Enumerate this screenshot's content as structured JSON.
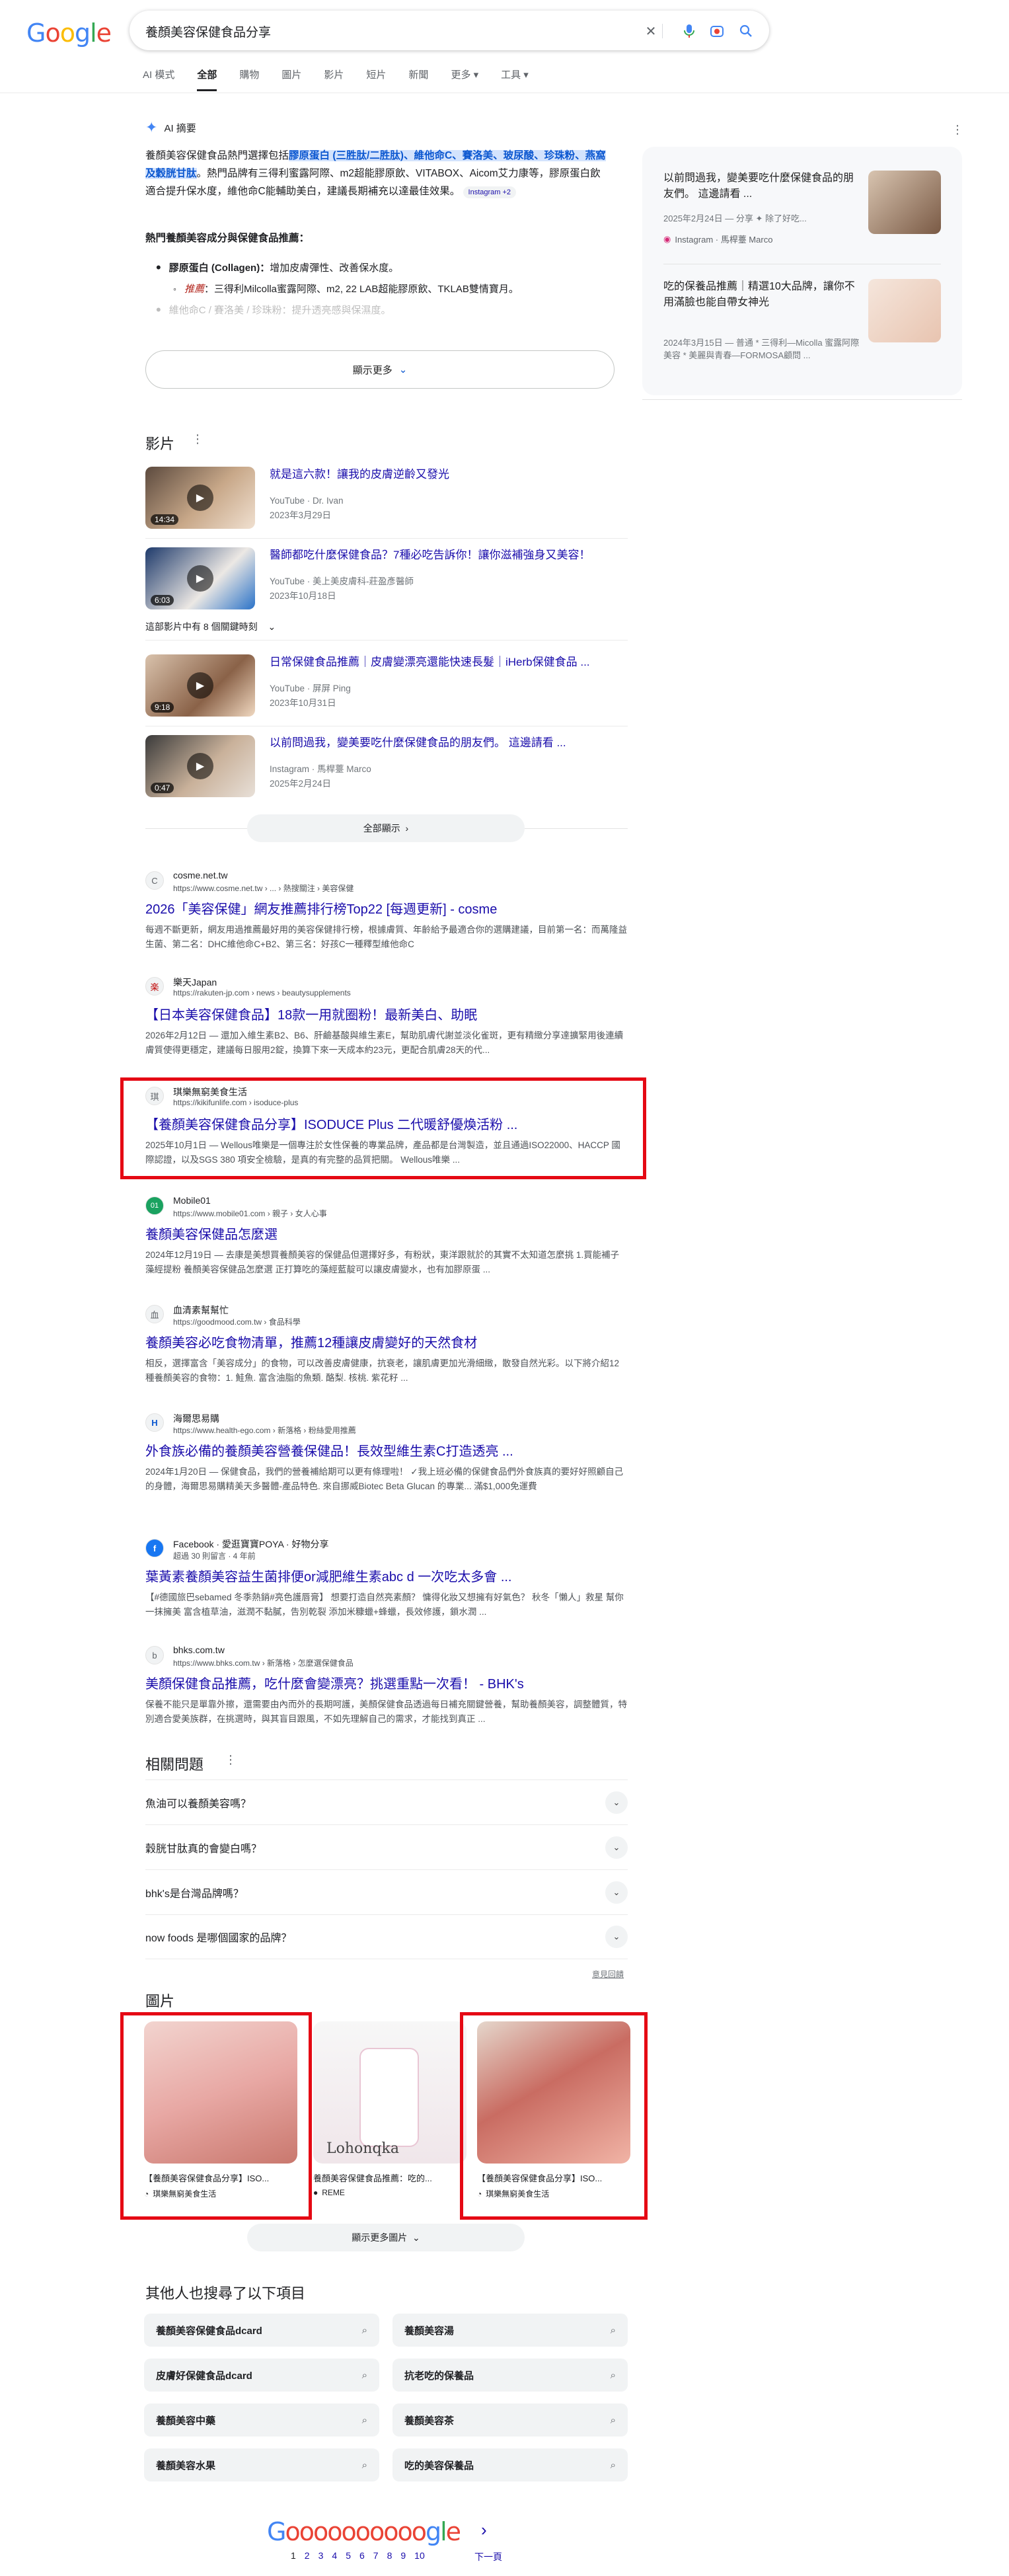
{
  "header": {
    "logo": "Google",
    "search_query": "養顏美容保健食品分享",
    "nav_tabs": [
      "AI 模式",
      "全部",
      "購物",
      "圖片",
      "影片",
      "短片",
      "新聞",
      "更多 ▾",
      "工具 ▾"
    ]
  },
  "ai_overview": {
    "label": "AI 摘要",
    "p1_a": "養顏美容保健食品熱門選擇包括",
    "p1_hl": "膠原蛋白 (三胜肽/二胜肽)、維他命C、賽洛美、玻尿酸、珍珠粉、燕窩及穀胱甘肽",
    "p1_b": "。熱門品牌有三得利蜜露阿際、m2超能膠原飲、VITABOX、Aicom艾力康等，膠原蛋白飲適合提升保水度，維他命C能輔助美白，建議長期補充以達最佳效果。",
    "p1_pill": "Instagram +2",
    "heading": "熱門養顏美容成分與保健食品推薦：",
    "bullet1_label": "膠原蛋白 (Collagen)：",
    "bullet1_text": "增加皮膚彈性、改善保水度。",
    "sub_label": "推薦",
    "sub_text": "三得利Milcolla蜜露阿際、m2, 22 LAB超能膠原飲、TKLAB雙情寶月。",
    "bullet2_text": "維他命C / 賽洛美 / 珍珠粉：",
    "bullet2_more": "提升透亮感與保濕度。",
    "show_more": "顯示更多",
    "side_cards": [
      {
        "title": "以前問過我，變美要吃什麼保健食品的朋友們。 這邊請看 ...",
        "meta": "2025年2月24日 — 分享 ✦ 除了好吃...",
        "source": "Instagram · 馬桿薹 Marco"
      },
      {
        "title": "吃的保養品推薦｜精選10大品牌，讓你不用滿臉也能自帶女神光",
        "meta": "2024年3月15日 — 普通 * 三得利—Micolla 蜜露阿際美容 * 美麗與青春—FORMOSA顧問 ...",
        "source": ""
      }
    ]
  },
  "videos": {
    "title": "影片",
    "items": [
      {
        "title": "就是這六款！讓我的皮膚逆齡又發光",
        "source": "YouTube · Dr. Ivan",
        "date": "2023年3月29日",
        "duration": "14:34"
      },
      {
        "title": "醫師都吃什麼保健食品？7種必吃告訴你！讓你滋補強身又美容！",
        "source": "YouTube · 美上美皮膚科-莊盈彥醫師",
        "date": "2023年10月18日",
        "duration": "6:03"
      },
      {
        "title": "日常保健食品推薦｜皮膚變漂亮還能快速長髮｜iHerb保健食品 ...",
        "source": "YouTube · 屏屏 Ping",
        "date": "2023年10月31日",
        "duration": "9:18"
      },
      {
        "title": "以前問過我，變美要吃什麼保健食品的朋友們。 這邊請看 ...",
        "source": "Instagram · 馬桿薹 Marco",
        "date": "2025年2月24日",
        "duration": "0:47"
      }
    ],
    "key_moments": "這部影片中有 8 個關鍵時刻",
    "show_all": "全部顯示"
  },
  "results": [
    {
      "site": "cosme.net.tw",
      "url": "https://www.cosme.net.tw › ... › 熱搜關注 › 美容保健",
      "title": "2026「美容保健」網友推薦排行榜Top22 [每週更新] - cosme",
      "snippet": "每週不斷更新，網友用過推薦最好用的美容保健排行榜，根據膚質、年齡給予最適合你的選購建議，目前第一名：而萬隆益生菌、第二名：DHC維他命C+B2、第三名：好孩C一種釋型維他命C",
      "favicon": "C"
    },
    {
      "site": "樂天Japan",
      "url": "https://rakuten-jp.com › news › beautysupplements",
      "title": "【日本美容保健食品】18款一用就圈粉！最新美白、助眠",
      "snippet": "2026年2月12日 — 還加入維生素B2、B6、肝鹼基酸與維生素E，幫助肌膚代謝並淡化雀斑，更有精緻分享達擴緊用後連續膚質使得更穩定，建議每日服用2錠，換算下來一天成本約23元，更配合肌膚28天的代...",
      "favicon": "楽"
    },
    {
      "site": "琪樂無窮美食生活",
      "url": "https://kikifunlife.com › isoduce-plus",
      "title": "【養顏美容保健食品分享】ISODUCE Plus 二代暖舒優煥活粉 ...",
      "snippet": "2025年10月1日 — Wellous唯樂是一個專注於女性保養的專業品牌，產品都是台灣製造，並且通過ISO22000、HACCP 國際認證，以及SGS 380 項安全檢驗，是真的有完整的品質把關。 Wellous唯樂 ...",
      "favicon": "琪"
    },
    {
      "site": "Mobile01",
      "url": "https://www.mobile01.com › 親子 › 女人心事",
      "title": "養顏美容保健品怎麼選",
      "snippet": "2024年12月19日 — 去康是美想買養顏美容的保健品但選擇好多，有粉狀，東洋跟就於的其實不太知道怎麼挑 1.買能補子藻經提粉 養顏美容保健品怎麼選 正打算吃的藻經藍靛可以讓皮膚變水，也有加膠原蛋 ...",
      "favicon": "01"
    },
    {
      "site": "血清素幫幫忙",
      "url": "https://goodmood.com.tw › 食品科學",
      "title": "養顏美容必吃食物清單，推薦12種讓皮膚變好的天然食材",
      "snippet": "相反，選擇富含「美容成分」的食物，可以改善皮膚健康，抗衰老，讓肌膚更加光滑細緻，散發自然光彩。以下將介紹12 種養顏美容的食物：1. 鮭魚. 富含油脂的魚類. 酪梨. 核桃. 紫花籽 ...",
      "favicon": "血"
    },
    {
      "site": "海爾思易購",
      "url": "https://www.health-ego.com › 新落格 › 粉絲愛用推薦",
      "title": "外食族必備的養顏美容營養保健品！長效型維生素C打造透亮 ...",
      "snippet": "2024年1月20日 — 保健食品，我們的營養補給期可以更有條理啦！ ✓我上班必備的保健食品們外食族真的要好好照顧自己的身體，海爾思易購精美天多醫體-產品特色. 來自挪威Biotec Beta Glucan 的專業... 滿$1,000免運費",
      "favicon": "H"
    },
    {
      "site": "Facebook · 愛逛寶寶POYA · 好物分享",
      "url": "超過 30 則留言 · 4 年前",
      "title": "葉黃素養顏美容益生菌排便or減肥維生素abc d 一次吃太多會 ...",
      "snippet": "【#德國旅巴sebamed 冬季熱銷#亮色護唇膏】 想要打造自然亮素顏？ 慵得化妝又想擁有好氣色？ 秋冬「懶人」救星 幫你一抹擁美 富含植草油，滋潤不黏膩，告別乾裂 添加米糠蠟+蜂蠟，長效修護，鎖水潤 ...",
      "favicon": "f"
    },
    {
      "site": "bhks.com.tw",
      "url": "https://www.bhks.com.tw › 新落格 › 怎麼選保健食品",
      "title": "美顏保健食品推薦，吃什麼會變漂亮？挑選重點一次看！ - BHK's",
      "snippet": "保養不能只是單靠外擦，還需要由內而外的長期呵護，美顏保健食品透過每日補充關鍵營養，幫助養顏美容，調整體質，特別適合愛美族群，在挑選時，與其盲目跟風，不如先理解自己的需求，才能找到真正 ...",
      "favicon": "b"
    }
  ],
  "paa": {
    "title": "相關問題",
    "questions": [
      "魚油可以養顏美容嗎？",
      "穀胱甘肽真的會變白嗎？",
      "bhk's是台灣品牌嗎？",
      "now foods 是哪個國家的品牌？"
    ],
    "feedback": "意見回饋"
  },
  "images": {
    "title": "圖片",
    "items": [
      {
        "caption": "【養顏美容保健食品分享】ISO...",
        "source": "琪樂無窮美食生活"
      },
      {
        "caption": "養顏美容保健食品推薦：吃的...",
        "source": "REME"
      },
      {
        "caption": "【養顏美容保健食品分享】ISO...",
        "source": "琪樂無窮美食生活"
      }
    ],
    "show_more": "顯示更多圖片"
  },
  "related": {
    "title": "其他人也搜尋了以下項目",
    "chips": [
      "養顏美容保健食品dcard",
      "養顏美容湯",
      "皮膚好保健食品dcard",
      "抗老吃的保養品",
      "養顏美容中藥",
      "養顏美容茶",
      "養顏美容水果",
      "吃的美容保養品"
    ]
  },
  "pagination": {
    "logo": "Gooooooooooogle",
    "pages": [
      "1",
      "2",
      "3",
      "4",
      "5",
      "6",
      "7",
      "8",
      "9",
      "10"
    ],
    "next": "下一頁"
  },
  "colors": {
    "link": "#1a0dab",
    "highlight": "#d3e3fd",
    "annotation_box": "#e50914"
  }
}
